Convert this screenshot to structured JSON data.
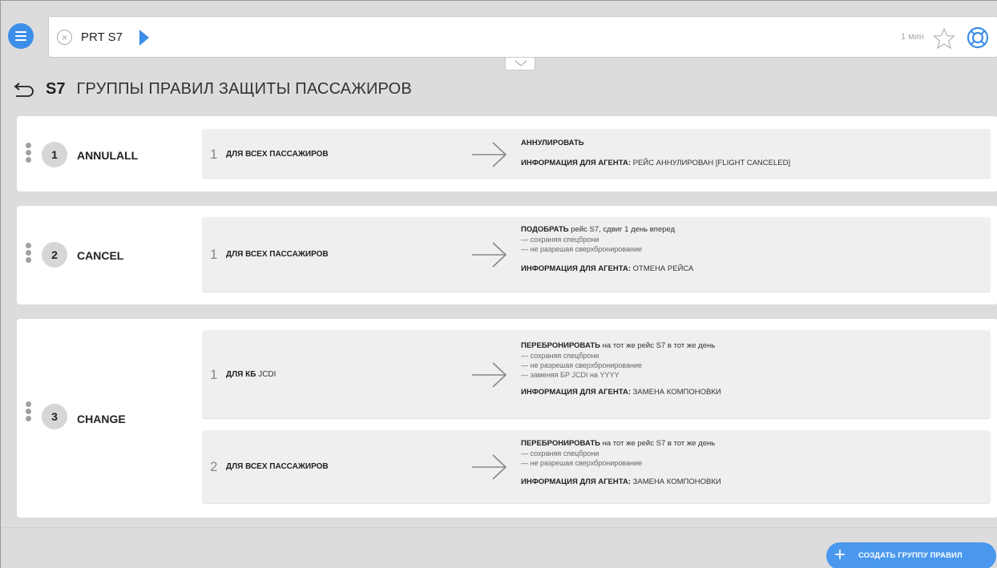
{
  "search": {
    "query": "PRT S7",
    "time_label": "1 мин"
  },
  "header": {
    "code": "S7",
    "title": "ГРУППЫ ПРАВИЛ ЗАЩИТЫ ПАССАЖИРОВ"
  },
  "groups": [
    {
      "num": "1",
      "name": "ANNULALL",
      "rules": [
        {
          "num": "1",
          "cond_bold": "ДЛЯ ВСЕХ ПАССАЖИРОВ",
          "cond_normal": "",
          "action_bold": "АННУЛИРОВАТЬ",
          "action_rest": "",
          "notes": [],
          "agent_label": "ИНФОРМАЦИЯ ДЛЯ АГЕНТА:",
          "agent_value": "РЕЙС АННУЛИРОВАН [FLIGHT CANCELED]"
        }
      ]
    },
    {
      "num": "2",
      "name": "CANCEL",
      "rules": [
        {
          "num": "1",
          "cond_bold": "ДЛЯ ВСЕХ ПАССАЖИРОВ",
          "cond_normal": "",
          "action_bold": "ПОДОБРАТЬ",
          "action_rest": "рейс S7, сдвиг 1 день вперед",
          "notes": [
            "— сохраняя спецброни",
            "— не разрешая сверхбронирование"
          ],
          "agent_label": "ИНФОРМАЦИЯ ДЛЯ АГЕНТА:",
          "agent_value": "ОТМЕНА РЕЙСА"
        }
      ]
    },
    {
      "num": "3",
      "name": "CHANGE",
      "rules": [
        {
          "num": "1",
          "cond_bold": "ДЛЯ КБ",
          "cond_normal": "JCDI",
          "action_bold": "ПЕРЕБРОНИРОВАТЬ",
          "action_rest": "на тот же рейс S7 в тот же день",
          "notes": [
            "— сохраняя спецброни",
            "— не разрешая сверхбронирование",
            "— заменяя БР JCDI на YYYY"
          ],
          "agent_label": "ИНФОРМАЦИЯ ДЛЯ АГЕНТА:",
          "agent_value": "ЗАМЕНА КОМПОНОВКИ"
        },
        {
          "num": "2",
          "cond_bold": "ДЛЯ ВСЕХ ПАССАЖИРОВ",
          "cond_normal": "",
          "action_bold": "ПЕРЕБРОНИРОВАТЬ",
          "action_rest": "на тот же рейс S7 в тот же день",
          "notes": [
            "— сохраняя спецброни",
            "— не разрешая сверхбронирование"
          ],
          "agent_label": "ИНФОРМАЦИЯ ДЛЯ АГЕНТА:",
          "agent_value": "ЗАМЕНА КОМПОНОВКИ"
        }
      ]
    }
  ],
  "footer": {
    "create_label": "СОЗДАТЬ ГРУППУ ПРАВИЛ"
  },
  "icons": [
    "menu-icon",
    "clear-icon",
    "run-icon",
    "chevron-down-icon",
    "star-icon",
    "help-icon",
    "back-icon",
    "drag-handle-icon",
    "arrow-right-icon",
    "plus-icon"
  ],
  "colors": {
    "accent": "#3d8ee8",
    "card": "#ffffff",
    "rule_bg": "#efefef",
    "page_bg": "#dcdcdc"
  }
}
